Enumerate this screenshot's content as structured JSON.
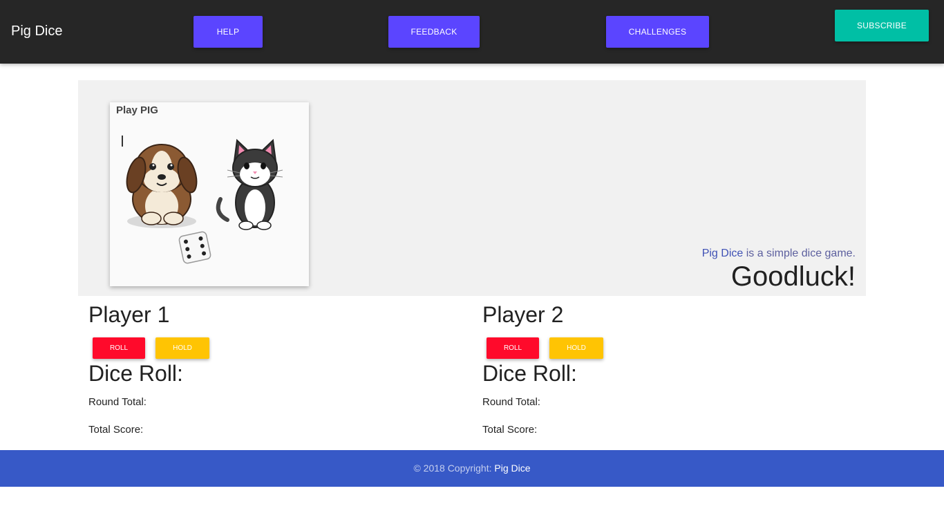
{
  "navbar": {
    "brand": "Pig Dice",
    "help_label": "HELP",
    "feedback_label": "FEEDBACK",
    "challenges_label": "CHALLENGES",
    "subscribe_label": "SUBSCRIBE"
  },
  "hero": {
    "card_title": "Play PIG",
    "intro_link": "Pig Dice",
    "intro_rest": " is a simple dice game.",
    "headline": "Goodluck!"
  },
  "players": [
    {
      "name": "Player 1",
      "roll_label": "ROLL",
      "hold_label": "HOLD",
      "dice_roll_label": "Dice Roll:",
      "round_total_label": "Round Total:",
      "total_score_label": "Total Score:"
    },
    {
      "name": "Player 2",
      "roll_label": "ROLL",
      "hold_label": "HOLD",
      "dice_roll_label": "Dice Roll:",
      "round_total_label": "Round Total:",
      "total_score_label": "Total Score:"
    }
  ],
  "footer": {
    "copyright": "© 2018 Copyright: ",
    "link": "Pig Dice"
  },
  "colors": {
    "navbar_bg": "#262626",
    "nav_button": "#5b45ff",
    "subscribe_button": "#00bfa5",
    "roll_button": "#ff0a2b",
    "hold_button": "#ffc403",
    "footer_bg": "#3759c7"
  },
  "icons": [
    "puppy-illustration",
    "kitten-illustration",
    "dice-icon"
  ]
}
